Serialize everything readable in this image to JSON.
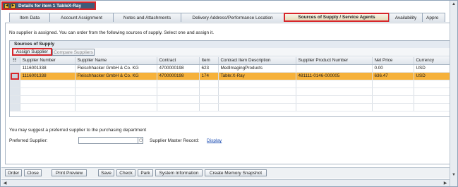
{
  "window": {
    "title": "Details for item 1 TableX-Ray",
    "nav_prev_icon": "arrow-left-icon",
    "nav_next_icon": "arrow-right-icon"
  },
  "tabs": [
    {
      "label": "Item Data"
    },
    {
      "label": "Account Assignment"
    },
    {
      "label": "Notes and Attachments"
    },
    {
      "label": "Delivery Address/Performance Location"
    },
    {
      "label": "Sources of Supply / Service Agents",
      "active": true
    },
    {
      "label": "Availability"
    },
    {
      "label": "Appro"
    }
  ],
  "info_message": "No supplier is assigned. You can order from the following sources of supply. Select one and assign it.",
  "sources_of_supply": {
    "title": "Sources of Supply",
    "assign_button": "Assign Supplier",
    "compare_button": "Compare Suppliers",
    "columns": [
      "Supplier Number",
      "Supplier Name",
      "Contract",
      "Item",
      "Contract Item Description",
      "Supplier Product Number",
      "Net Price",
      "Currency"
    ],
    "rows": [
      {
        "supplier_number": "1116001338",
        "supplier_name": "Fleischhacker GmbH & Co. KG",
        "contract": "4700000198",
        "item": "623",
        "description": "MedImagingProducts",
        "product_number": "",
        "net_price": "0.00",
        "currency": "USD"
      },
      {
        "supplier_number": "1116001338",
        "supplier_name": "Fleischhacker GmbH & Co. KG",
        "contract": "4700000198",
        "item": "174",
        "description": "Table:X-Ray",
        "product_number": "481111-0146-000005",
        "net_price": "636.47",
        "currency": "USD",
        "selected": true
      }
    ]
  },
  "suggest_text": "You may suggest a preferred supplier to the purchasing department",
  "preferred_supplier": {
    "label": "Preferred Supplier:",
    "value": "",
    "master_record_label": "Supplier Master Record:",
    "display_link": "Display"
  },
  "bottom_buttons": [
    "Order",
    "Close",
    "Print Preview",
    "Save",
    "Check",
    "Park",
    "System Information",
    "Create Memory Snapshot"
  ],
  "colors": {
    "highlight_red": "#d7262b",
    "selected_row": "#f6b13a",
    "titlebar": "#3f5b78",
    "link": "#1f4fb3"
  }
}
